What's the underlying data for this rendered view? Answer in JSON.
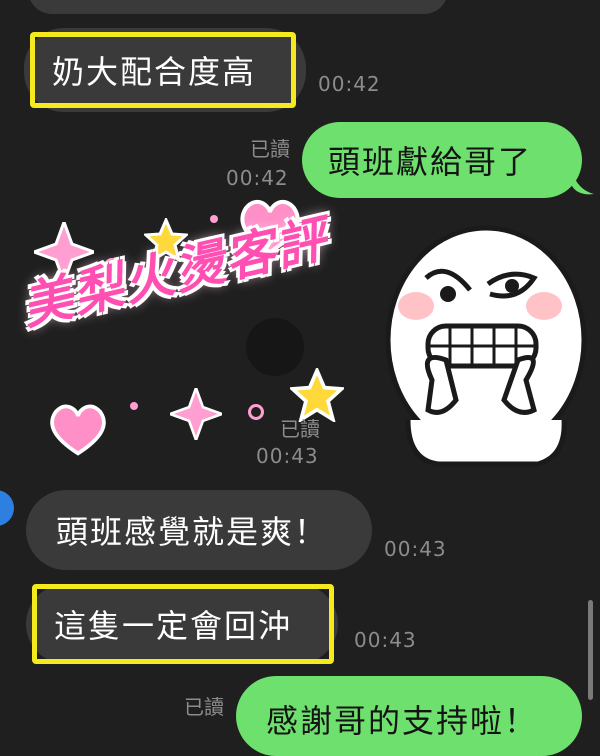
{
  "messages": [
    {
      "text": "奶大配合度高",
      "time": "00:42"
    },
    {
      "text": "頭班獻給哥了",
      "read": "已讀",
      "time": "00:42"
    },
    {
      "read": "已讀",
      "time": "00:43"
    },
    {
      "text": "頭班感覺就是爽！",
      "time": "00:43"
    },
    {
      "text": "這隻一定會回沖",
      "time": "00:43"
    },
    {
      "text": "感謝哥的支持啦！",
      "read": "已讀"
    }
  ],
  "overlay": {
    "text": "美梨火燙客評"
  },
  "colors": {
    "background": "#1f1f1f",
    "incoming_bubble": "#3a3a3a",
    "outgoing_bubble": "#6ee06d",
    "highlight": "#f4ea1d",
    "meta_text": "#8c8c8c",
    "overlay_pink": "#ff4fb2"
  },
  "icons": [
    "sparkle-star-icon",
    "heart-icon",
    "line-moon-sticker"
  ]
}
